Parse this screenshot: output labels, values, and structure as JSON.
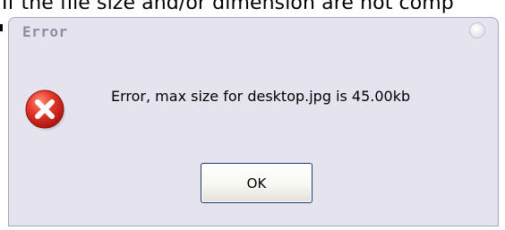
{
  "background_text": "If the file size and/or dimension are not comp",
  "dialog": {
    "title": "Error",
    "message": "Error, max size for desktop.jpg is 45.00kb",
    "ok_label": "OK"
  },
  "icons": {
    "error": "error-x-icon",
    "close": "close-circle-icon"
  },
  "colors": {
    "dialog_bg": "#e4e3ee",
    "title_text": "#8e8ca0",
    "error_red": "#d9281d"
  }
}
